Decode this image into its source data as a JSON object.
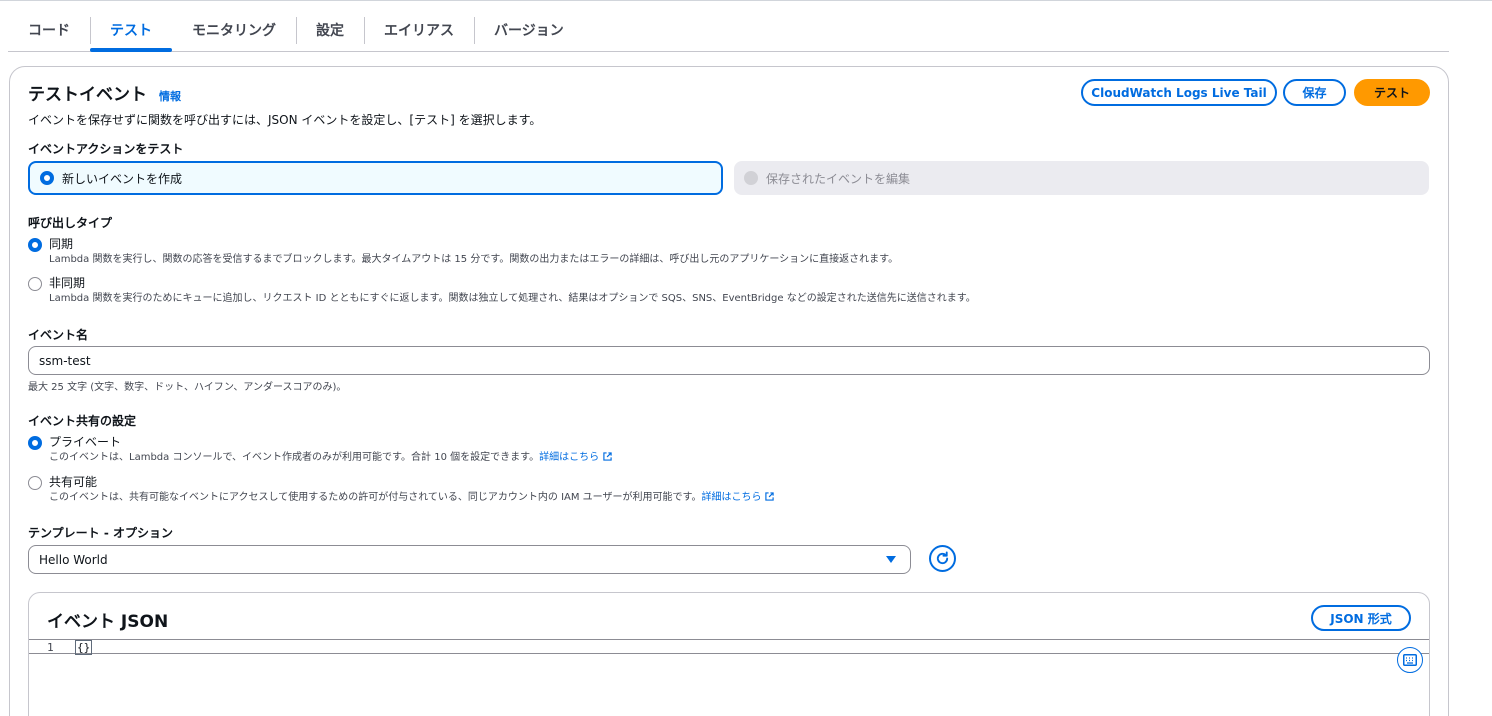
{
  "tabs": [
    {
      "label": "コード"
    },
    {
      "label": "テスト"
    },
    {
      "label": "モニタリング"
    },
    {
      "label": "設定"
    },
    {
      "label": "エイリアス"
    },
    {
      "label": "バージョン"
    }
  ],
  "header": {
    "title": "テストイベント",
    "info": "情報",
    "description": "イベントを保存せずに関数を呼び出すには、JSON イベントを設定し、[テスト] を選択します。",
    "buttons": {
      "live_tail": "CloudWatch Logs Live Tail",
      "save": "保存",
      "test": "テスト"
    }
  },
  "event_action": {
    "label": "イベントアクションをテスト",
    "options": [
      {
        "label": "新しいイベントを作成",
        "selected": true
      },
      {
        "label": "保存されたイベントを編集",
        "selected": false,
        "disabled": true
      }
    ]
  },
  "invocation_type": {
    "label": "呼び出しタイプ",
    "options": [
      {
        "label": "同期",
        "selected": true,
        "description": "Lambda 関数を実行し、関数の応答を受信するまでブロックします。最大タイムアウトは 15 分です。関数の出力またはエラーの詳細は、呼び出し元のアプリケーションに直接返されます。"
      },
      {
        "label": "非同期",
        "selected": false,
        "description": "Lambda 関数を実行のためにキューに追加し、リクエスト ID とともにすぐに返します。関数は独立して処理され、結果はオプションで SQS、SNS、EventBridge などの設定された送信先に送信されます。"
      }
    ]
  },
  "event_name": {
    "label": "イベント名",
    "value": "ssm-test",
    "hint": "最大 25 文字 (文字、数字、ドット、ハイフン、アンダースコアのみ)。"
  },
  "sharing": {
    "label": "イベント共有の設定",
    "options": [
      {
        "label": "プライベート",
        "selected": true,
        "description": "このイベントは、Lambda コンソールで、イベント作成者のみが利用可能です。合計 10 個を設定できます。",
        "link": "詳細はこちら"
      },
      {
        "label": "共有可能",
        "selected": false,
        "description": "このイベントは、共有可能なイベントにアクセスして使用するための許可が付与されている、同じアカウント内の IAM ユーザーが利用可能です。",
        "link": "詳細はこちら"
      }
    ]
  },
  "template": {
    "label": "テンプレート - オプション",
    "value": "Hello World"
  },
  "event_json": {
    "title": "イベント JSON",
    "format_button": "JSON 形式",
    "line_number": "1",
    "code": "{}"
  },
  "colors": {
    "accent": "#006ce0",
    "primary_button": "#ff9900"
  }
}
